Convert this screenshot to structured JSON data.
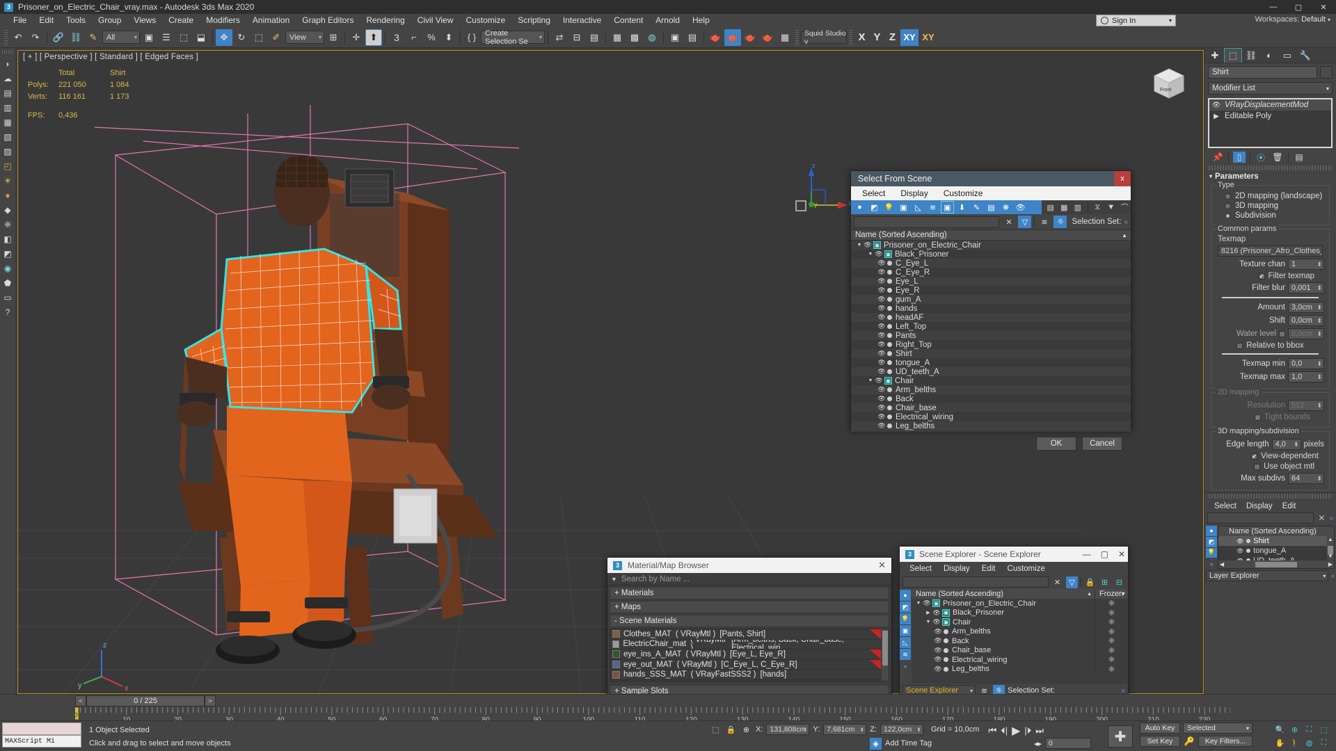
{
  "window": {
    "title": "Prisoner_on_Electric_Chair_vray.max - Autodesk 3ds Max 2020",
    "logo_text": "3",
    "minimize": "—",
    "maximize": "▢",
    "close": "✕"
  },
  "menu": {
    "items": [
      "File",
      "Edit",
      "Tools",
      "Group",
      "Views",
      "Create",
      "Modifiers",
      "Animation",
      "Graph Editors",
      "Rendering",
      "Civil View",
      "Customize",
      "Scripting",
      "Interactive",
      "Content",
      "Arnold",
      "Help"
    ],
    "sign_in": "Sign In",
    "workspace_label": "Workspaces:",
    "workspace_value": "Default"
  },
  "toolbar": {
    "selection_filter": "All",
    "reference_coord": "View",
    "selection_set": "Create Selection Se",
    "render_preset": "Squid Studio v",
    "axis_x": "X",
    "axis_y": "Y",
    "axis_z": "Z",
    "axis_xy": "XY",
    "axis_xy2": "XY"
  },
  "viewport": {
    "label": "[ + ] [ Perspective ] [ Standard ] [ Edged Faces ]",
    "stats": {
      "col_total": "Total",
      "col_object": "Shirt",
      "polys_label": "Polys:",
      "polys_total": "221 050",
      "polys_obj": "1 084",
      "verts_label": "Verts:",
      "verts_total": "116 161",
      "verts_obj": "1 173",
      "fps_label": "FPS:",
      "fps_value": "0,436"
    },
    "axis_x": "x",
    "axis_y": "y",
    "axis_z": "z",
    "cube_label": "Front"
  },
  "select_from_scene": {
    "title": "Select From Scene",
    "close": "x",
    "menu": [
      "Select",
      "Display",
      "Customize"
    ],
    "search_placeholder": "",
    "selection_set_label": "Selection Set:",
    "column_header": "Name (Sorted Ascending)",
    "ok": "OK",
    "cancel": "Cancel",
    "tree": [
      {
        "name": "Prisoner_on_Electric_Chair",
        "depth": 0,
        "type": "group",
        "expanded": true
      },
      {
        "name": "Black_Prisoner",
        "depth": 1,
        "type": "group",
        "expanded": true
      },
      {
        "name": "C_Eye_L",
        "depth": 2,
        "type": "obj"
      },
      {
        "name": "C_Eye_R",
        "depth": 2,
        "type": "obj"
      },
      {
        "name": "Eye_L",
        "depth": 2,
        "type": "obj"
      },
      {
        "name": "Eye_R",
        "depth": 2,
        "type": "obj"
      },
      {
        "name": "gum_A",
        "depth": 2,
        "type": "obj"
      },
      {
        "name": "hands",
        "depth": 2,
        "type": "obj"
      },
      {
        "name": "headAF",
        "depth": 2,
        "type": "obj"
      },
      {
        "name": "Left_Top",
        "depth": 2,
        "type": "obj"
      },
      {
        "name": "Pants",
        "depth": 2,
        "type": "obj"
      },
      {
        "name": "Right_Top",
        "depth": 2,
        "type": "obj"
      },
      {
        "name": "Shirt",
        "depth": 2,
        "type": "obj"
      },
      {
        "name": "tongue_A",
        "depth": 2,
        "type": "obj"
      },
      {
        "name": "UD_teeth_A",
        "depth": 2,
        "type": "obj"
      },
      {
        "name": "Chair",
        "depth": 1,
        "type": "group",
        "expanded": true
      },
      {
        "name": "Arm_belths",
        "depth": 2,
        "type": "obj"
      },
      {
        "name": "Back",
        "depth": 2,
        "type": "obj"
      },
      {
        "name": "Chair_base",
        "depth": 2,
        "type": "obj"
      },
      {
        "name": "Electrical_wiring",
        "depth": 2,
        "type": "obj"
      },
      {
        "name": "Leg_belths",
        "depth": 2,
        "type": "obj"
      }
    ]
  },
  "material_browser": {
    "title": "Material/Map Browser",
    "logo_text": "3",
    "close": "✕",
    "search_placeholder": "Search by Name ...",
    "groups": [
      {
        "label": "+ Materials"
      },
      {
        "label": "+ Maps"
      },
      {
        "label": "- Scene Materials"
      }
    ],
    "sample_slots": "+ Sample Slots",
    "materials": [
      {
        "name": "Clothes_MAT",
        "type": "( VRayMtl )",
        "objects": "[Pants, Shirt]",
        "swatch": "#8a5a44",
        "flag": true
      },
      {
        "name": "ElectricChair_mat",
        "type": "( VRayMtl )",
        "objects": "[Arm_belths, Back, Chair_base, Electrical_wiri...",
        "swatch": "#9a9a9a",
        "flag": false
      },
      {
        "name": "eye_ins_A_MAT",
        "type": "( VRayMtl )",
        "objects": "[Eye_L, Eye_R]",
        "swatch": "#335533",
        "flag": true
      },
      {
        "name": "eye_out_MAT",
        "type": "( VRayMtl )",
        "objects": "[C_Eye_L, C_Eye_R]",
        "swatch": "#556688",
        "flag": true
      },
      {
        "name": "hands_SSS_MAT",
        "type": "( VRayFastSSS2 )",
        "objects": "[hands]",
        "swatch": "#7a5540",
        "flag": false
      }
    ]
  },
  "scene_explorer": {
    "title": "Scene Explorer - Scene Explorer",
    "logo_text": "3",
    "minimize": "—",
    "maximize": "▢",
    "close": "✕",
    "menu": [
      "Select",
      "Display",
      "Edit",
      "Customize"
    ],
    "column_name": "Name (Sorted Ascending)",
    "column_frozen": "Frozen",
    "footer_dropdown": "Scene Explorer",
    "selection_set_label": "Selection Set:",
    "tree": [
      {
        "name": "Prisoner_on_Electric_Chair",
        "depth": 0,
        "type": "group",
        "expanded": true
      },
      {
        "name": "Black_Prisoner",
        "depth": 1,
        "type": "group",
        "expanded": false
      },
      {
        "name": "Chair",
        "depth": 1,
        "type": "group",
        "expanded": true
      },
      {
        "name": "Arm_belths",
        "depth": 2,
        "type": "obj"
      },
      {
        "name": "Back",
        "depth": 2,
        "type": "obj"
      },
      {
        "name": "Chair_base",
        "depth": 2,
        "type": "obj"
      },
      {
        "name": "Electrical_wiring",
        "depth": 2,
        "type": "obj"
      },
      {
        "name": "Leg_belths",
        "depth": 2,
        "type": "obj"
      }
    ]
  },
  "command_panel": {
    "object_name": "Shirt",
    "modifier_list": "Modifier List",
    "stack": [
      {
        "name": "VRayDisplacementMod",
        "italic": true,
        "selected": true
      },
      {
        "name": "Editable Poly",
        "italic": false,
        "selected": false
      }
    ],
    "parameters_title": "Parameters",
    "type_group": "Type",
    "type_options": [
      {
        "label": "2D mapping (landscape)",
        "selected": false
      },
      {
        "label": "3D mapping",
        "selected": false
      },
      {
        "label": "Subdivision",
        "selected": true
      }
    ],
    "common_group": "Common params",
    "texmap_label": "Texmap",
    "texmap_value": "8216 (Prisoner_Afro_Clothes_",
    "texture_chan_label": "Texture chan",
    "texture_chan_value": "1",
    "filter_texmap_label": "Filter texmap",
    "filter_texmap_checked": true,
    "filter_blur_label": "Filter blur",
    "filter_blur_value": "0,001",
    "amount_label": "Amount",
    "amount_value": "3,0cm",
    "shift_label": "Shift",
    "shift_value": "0,0cm",
    "water_level_label": "Water level",
    "water_level_value": "0,0cm",
    "relative_bbox_label": "Relative to bbox",
    "texmap_min_label": "Texmap min",
    "texmap_min_value": "0,0",
    "texmap_max_label": "Texmap max",
    "texmap_max_value": "1,0",
    "mapping2d_group": "2D mapping",
    "resolution_label": "Resolution",
    "resolution_value": "512",
    "tight_bounds_label": "Tight bounds",
    "mapping3d_group": "3D mapping/subdivision",
    "edge_length_label": "Edge length",
    "edge_length_value": "4,0",
    "edge_length_units": "pixels",
    "view_dependent_label": "View-dependent",
    "use_object_mtl_label": "Use object mtl",
    "max_subdivs_label": "Max subdivs",
    "max_subdivs_value": "64"
  },
  "layer_explorer": {
    "menu": [
      "Select",
      "Display",
      "Edit"
    ],
    "column_name": "Name (Sorted Ascending)",
    "footer_dropdown": "Layer Explorer",
    "rows": [
      {
        "name": "Shirt",
        "selected": true
      },
      {
        "name": "tongue_A",
        "selected": false
      },
      {
        "name": "UD_teeth_A",
        "selected": false
      }
    ]
  },
  "time_slider": {
    "frame_field": "0 / 225",
    "prev": "<",
    "next": ">",
    "ticks": [
      "0",
      "10",
      "20",
      "30",
      "40",
      "50",
      "60",
      "70",
      "80",
      "90",
      "100",
      "110",
      "120",
      "130",
      "140",
      "150",
      "160",
      "170",
      "180",
      "190",
      "200",
      "210",
      "220"
    ]
  },
  "status_bar": {
    "maxscript_label": "MAXScript Mi",
    "selection_status": "1 Object Selected",
    "prompt": "Click and drag to select and move objects",
    "x_label": "X:",
    "x_value": "131,808cm",
    "y_label": "Y:",
    "y_value": "7,681cm",
    "z_label": "Z:",
    "z_value": "122,0cm",
    "grid_label": "Grid = 10,0cm",
    "add_time_tag": "Add Time Tag",
    "auto_key": "Auto Key",
    "set_key": "Set Key",
    "key_mode": "Selected",
    "key_filters": "Key Filters...",
    "current_frame": "0"
  },
  "colors": {
    "accent_blue": "#3e84c6",
    "teal": "#43c8c8",
    "viewport_border": "#b7931f",
    "stat_yellow": "#d9b84a",
    "dialog_title": "#4a5863",
    "close_red": "#b5403f"
  }
}
